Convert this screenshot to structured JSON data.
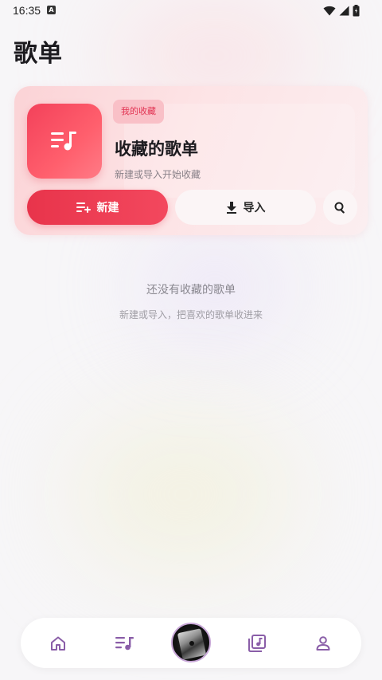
{
  "status_bar": {
    "time": "16:35",
    "notification_icon": "a-icon"
  },
  "page": {
    "title": "歌单"
  },
  "card": {
    "tag": "我的收藏",
    "title": "收藏的歌单",
    "subtitle": "新建或导入开始收藏",
    "cover_icon": "playlist-music-icon",
    "new_button": {
      "label": "新建",
      "icon": "playlist-add-icon"
    },
    "import_button": {
      "label": "导入",
      "icon": "download-icon"
    },
    "search_button": {
      "icon": "search-icon"
    }
  },
  "empty_state": {
    "title": "还没有收藏的歌单",
    "subtitle": "新建或导入，把喜欢的歌单收进来"
  },
  "bottom_nav": {
    "items": [
      {
        "icon": "home-icon"
      },
      {
        "icon": "playlist-icon",
        "active": true
      },
      {
        "icon": "now-playing-disc"
      },
      {
        "icon": "music-library-icon"
      },
      {
        "icon": "profile-icon"
      }
    ]
  },
  "colors": {
    "accent": "#e8344b",
    "nav_icon": "#8a5ea8",
    "background": "#f7f6f8"
  }
}
